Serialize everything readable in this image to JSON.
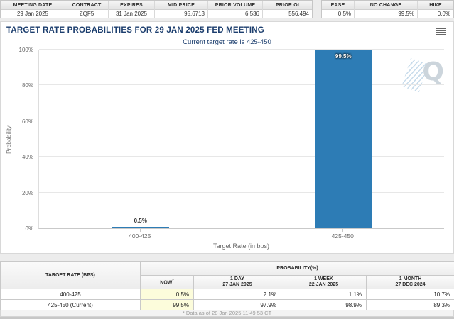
{
  "stats": {
    "left": [
      {
        "label": "MEETING DATE",
        "value": "29 Jan 2025"
      },
      {
        "label": "CONTRACT",
        "value": "ZQF5"
      },
      {
        "label": "EXPIRES",
        "value": "31 Jan 2025"
      },
      {
        "label": "MID PRICE",
        "value": "95.6713"
      },
      {
        "label": "PRIOR VOLUME",
        "value": "6,536"
      },
      {
        "label": "PRIOR OI",
        "value": "556,494"
      }
    ],
    "right": [
      {
        "label": "EASE",
        "value": "0.5%"
      },
      {
        "label": "NO CHANGE",
        "value": "99.5%"
      },
      {
        "label": "HIKE",
        "value": "0.0%"
      }
    ]
  },
  "chart": {
    "title": "TARGET RATE PROBABILITIES FOR 29 JAN 2025 FED MEETING",
    "subtitle": "Current target rate is 425-450",
    "watermark_letter": "Q",
    "menu_icon": "hamburger-icon"
  },
  "chart_data": {
    "type": "bar",
    "title": "TARGET RATE PROBABILITIES FOR 29 JAN 2025 FED MEETING",
    "subtitle": "Current target rate is 425-450",
    "categories": [
      "400-425",
      "425-450"
    ],
    "values": [
      0.5,
      99.5
    ],
    "bar_labels": [
      "0.5%",
      "99.5%"
    ],
    "xlabel": "Target Rate (in bps)",
    "ylabel": "Probability",
    "ylim": [
      0,
      100
    ],
    "yticks": [
      "0%",
      "20%",
      "40%",
      "60%",
      "80%",
      "100%"
    ],
    "grid": true,
    "legend": "none",
    "bar_color": "#2d7cb5"
  },
  "table": {
    "col1_header": "TARGET RATE (BPS)",
    "group_header": "PROBABILITY(%)",
    "sub": [
      {
        "l1": "NOW",
        "sup": "*",
        "l2": ""
      },
      {
        "l1": "1 DAY",
        "l2": "27 JAN 2025"
      },
      {
        "l1": "1 WEEK",
        "l2": "22 JAN 2025"
      },
      {
        "l1": "1 MONTH",
        "l2": "27 DEC 2024"
      }
    ],
    "rows": [
      {
        "rate": "400-425",
        "now": "0.5%",
        "day": "2.1%",
        "week": "1.1%",
        "month": "10.7%"
      },
      {
        "rate": "425-450 (Current)",
        "now": "99.5%",
        "day": "97.9%",
        "week": "98.9%",
        "month": "89.3%"
      }
    ],
    "footnote": "* Data as of 28 Jan 2025 11:49:53 CT"
  }
}
